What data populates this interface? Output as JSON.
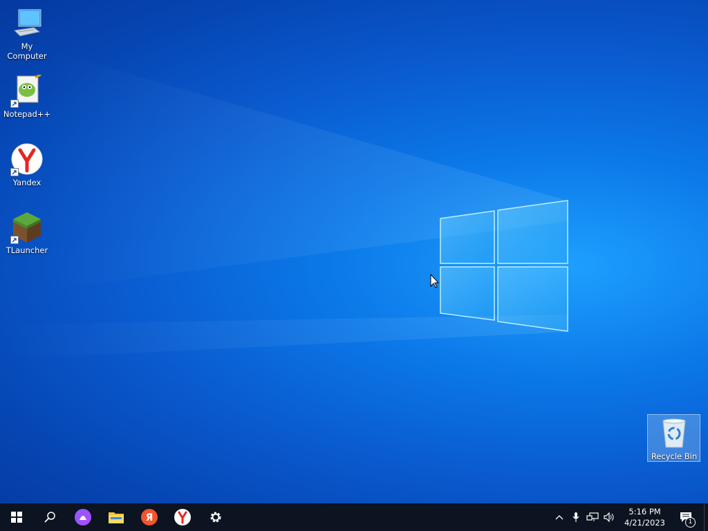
{
  "desktop": {
    "icons": [
      {
        "label": "My Computer"
      },
      {
        "label": "Notepad++"
      },
      {
        "label": "Yandex"
      },
      {
        "label": "TLauncher"
      }
    ],
    "recycle_bin": {
      "label": "Recycle Bin"
    }
  },
  "taskbar": {
    "pinned": [
      "start-icon",
      "search-icon",
      "alice-icon",
      "file-explorer-icon",
      "yandex-browser-icon",
      "yandex-icon",
      "settings-icon"
    ],
    "clock": {
      "time": "5:16 PM",
      "date": "4/21/2023"
    },
    "notifications_count": "1"
  }
}
